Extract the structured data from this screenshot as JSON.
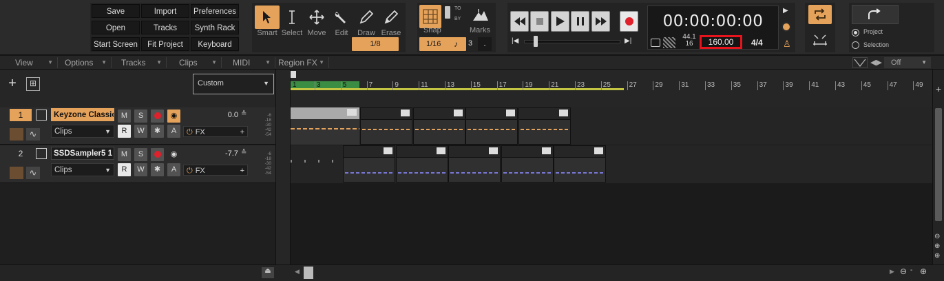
{
  "quick_access": {
    "buttons": [
      "Save",
      "Import",
      "Preferences",
      "Open",
      "Tracks",
      "Synth Rack",
      "Start Screen",
      "Fit Project",
      "Keyboard"
    ]
  },
  "tools": {
    "labels": [
      "Smart",
      "Select",
      "Move",
      "Edit",
      "Draw",
      "Erase"
    ],
    "draw_value": "1/8",
    "accent": "#e5a25a"
  },
  "snap": {
    "label": "Snap",
    "to": "TO",
    "by": "BY",
    "value": "1/16",
    "marks_label": "Marks",
    "marks_value": "3",
    "marks_dot": "."
  },
  "transport": {
    "time": "00:00:00:00",
    "sample_rate": "44.1",
    "bit_depth": "16",
    "tempo": "160.00",
    "meter": "4/4",
    "tempo_highlight": "#e8141d"
  },
  "timebase": {
    "project": "Project",
    "selection": "Selection"
  },
  "menus": [
    "View",
    "Options",
    "Tracks",
    "Clips",
    "MIDI",
    "Region FX"
  ],
  "lane": {
    "off": "Off",
    "custom": "Custom"
  },
  "ruler": {
    "labels": [
      "3",
      "5",
      "7",
      "9",
      "11",
      "13",
      "15",
      "17",
      "19",
      "21",
      "23",
      "25",
      "27",
      "29",
      "31",
      "33",
      "35",
      "37",
      "39",
      "41",
      "43",
      "45",
      "47",
      "49"
    ],
    "first": "1"
  },
  "tracks": [
    {
      "num": "1",
      "name": "Keyzone Classic",
      "clips": "Clips",
      "vol": "0.0",
      "m": "M",
      "s": "S",
      "r": "R",
      "w": "W",
      "a": "A",
      "fx": "FX",
      "db": [
        "-6",
        "-18",
        "-30",
        "-42",
        "-54"
      ]
    },
    {
      "num": "2",
      "name": "SSDSampler5 1",
      "clips": "Clips",
      "vol": "-7.7",
      "m": "M",
      "s": "S",
      "r": "R",
      "w": "W",
      "a": "A",
      "fx": "FX",
      "db": [
        "-6",
        "-18",
        "-30",
        "-42",
        "-54"
      ]
    }
  ]
}
